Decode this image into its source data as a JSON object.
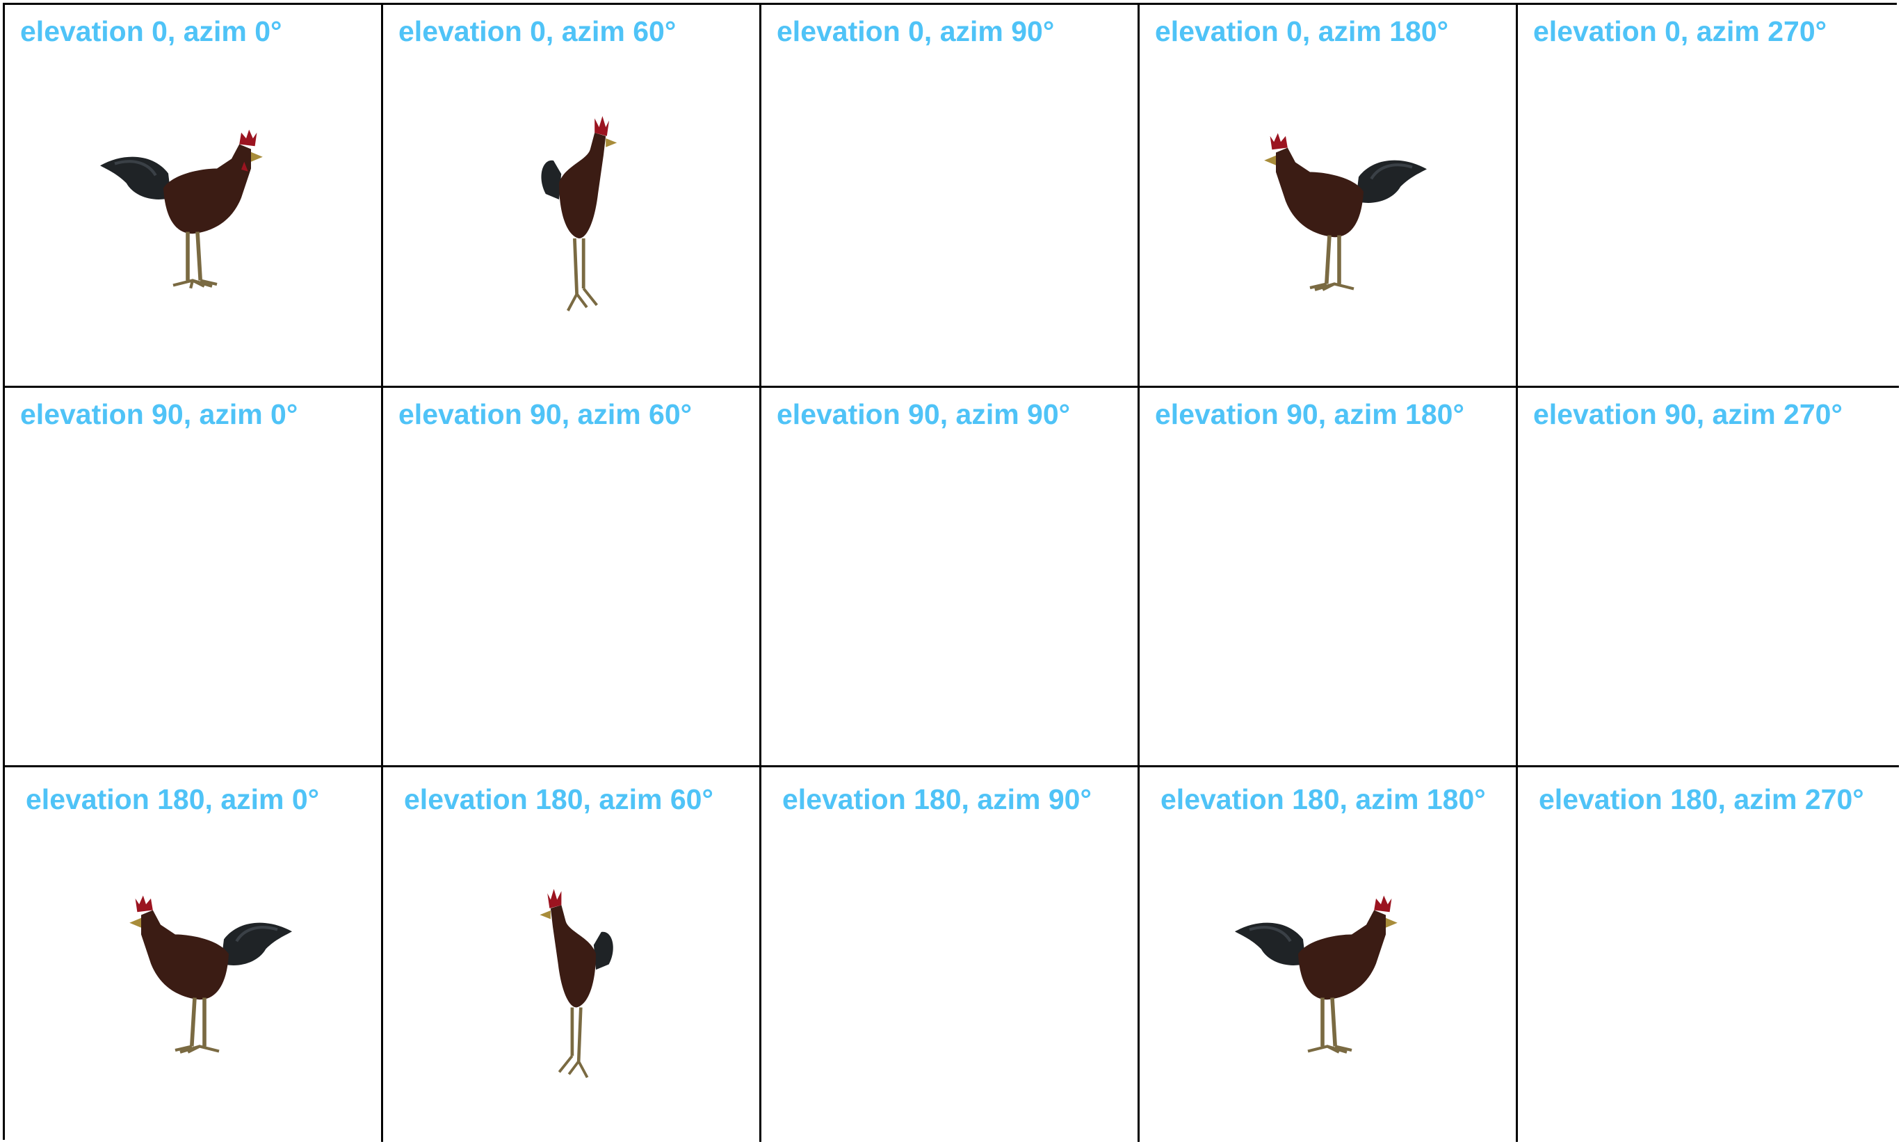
{
  "colors": {
    "label": "#4fc3f7",
    "grid_line": "#000000",
    "body": "#3b1c14",
    "tail": "#1f2326",
    "comb": "#9b1420",
    "legs": "#7a6a42"
  },
  "cells": [
    {
      "label": "elevation 0, azim 0°",
      "render": "rooster-side-left-facing-right"
    },
    {
      "label": "elevation 0, azim 60°",
      "render": "rooster-three-quarter-right"
    },
    {
      "label": "elevation 0, azim 90°",
      "render": "empty"
    },
    {
      "label": "elevation 0, azim 180°",
      "render": "rooster-side-facing-left"
    },
    {
      "label": "elevation 0, azim 270°",
      "render": "empty"
    },
    {
      "label": "elevation 90, azim 0°",
      "render": "empty"
    },
    {
      "label": "elevation 90, azim 60°",
      "render": "empty"
    },
    {
      "label": "elevation 90, azim 90°",
      "render": "empty"
    },
    {
      "label": "elevation 90, azim 180°",
      "render": "empty"
    },
    {
      "label": "elevation 90, azim 270°",
      "render": "empty"
    },
    {
      "label": "elevation 180, azim 0°",
      "render": "rooster-side-facing-left"
    },
    {
      "label": "elevation 180, azim 60°",
      "render": "rooster-three-quarter-left"
    },
    {
      "label": "elevation 180, azim 90°",
      "render": "empty"
    },
    {
      "label": "elevation 180, azim 180°",
      "render": "rooster-side-facing-right"
    },
    {
      "label": "elevation 180, azim 270°",
      "render": "empty"
    }
  ]
}
